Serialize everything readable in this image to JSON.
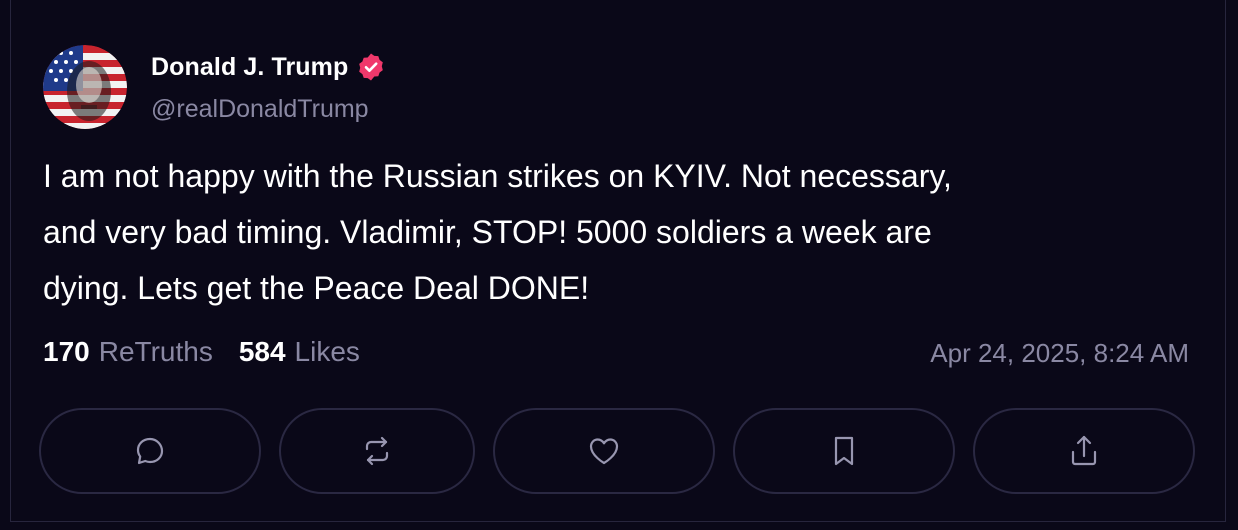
{
  "post": {
    "author": {
      "display_name": "Donald J. Trump",
      "handle": "@realDonaldTrump",
      "verified": true,
      "verified_color": "#f0386b",
      "avatar_icon": "avatar-flag-portrait"
    },
    "text": "I am not happy with the Russian strikes on KYIV. Not necessary,\nand very bad timing. Vladimir, STOP! 5000 soldiers a week are\ndying. Lets get the Peace Deal DONE!",
    "stats": {
      "retruths_count": "170",
      "retruths_label": "ReTruths",
      "likes_count": "584",
      "likes_label": "Likes"
    },
    "timestamp": "Apr 24, 2025, 8:24 AM"
  },
  "actions": [
    {
      "name": "reply",
      "icon": "comment-bubble-icon"
    },
    {
      "name": "retruth",
      "icon": "repost-arrows-icon"
    },
    {
      "name": "like",
      "icon": "heart-icon"
    },
    {
      "name": "bookmark",
      "icon": "bookmark-icon"
    },
    {
      "name": "share",
      "icon": "share-icon"
    }
  ],
  "colors": {
    "background": "#0a0818",
    "border": "#2a2842",
    "muted_text": "#8a88a3",
    "icon": "#9896b0"
  }
}
